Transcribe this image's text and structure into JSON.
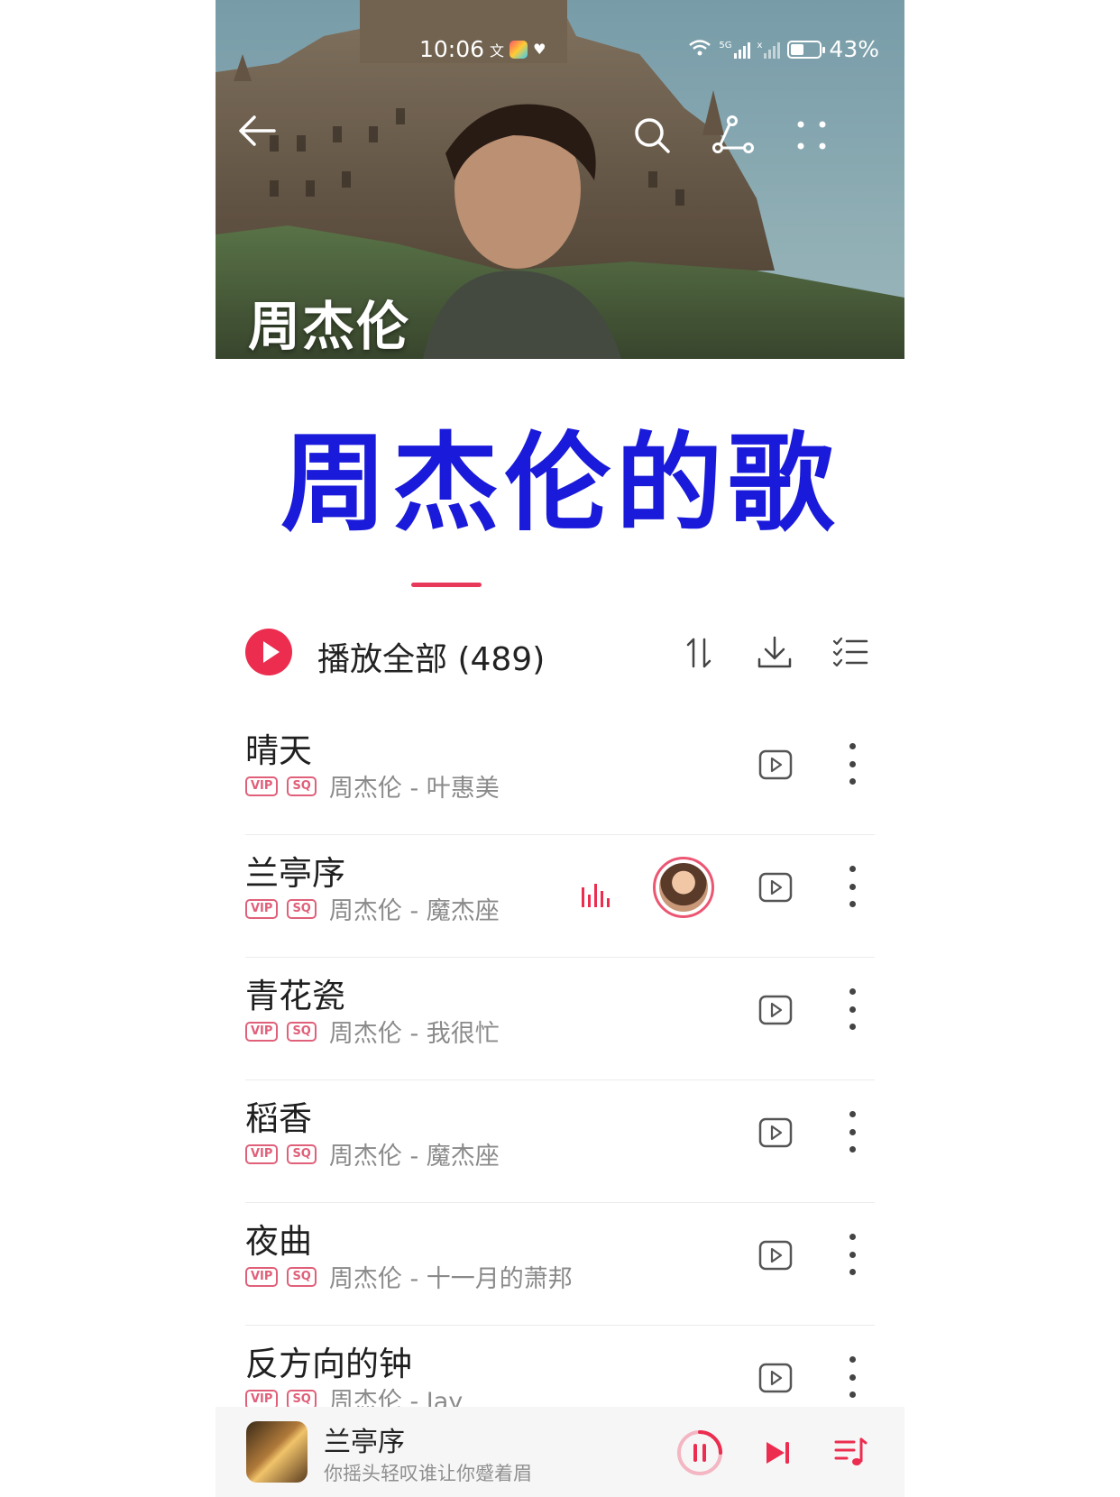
{
  "status_bar": {
    "time": "10:06",
    "battery": "43%",
    "network_5g": "5G",
    "network_x": "x"
  },
  "header": {
    "artist_name": "周杰伦",
    "back_icon": "arrow-left-icon",
    "search_icon": "search-icon",
    "share_icon": "share-icon",
    "more_icon": "more-dots-icon"
  },
  "overlay_title": "周杰伦的歌",
  "toolbar": {
    "play_all_label": "播放全部 (489)",
    "sort_icon": "sort-icon",
    "download_icon": "download-icon",
    "multi_select_icon": "checklist-icon"
  },
  "songs": [
    {
      "title": "晴天",
      "tags": [
        "VIP",
        "SQ"
      ],
      "subtitle": "周杰伦 - 叶惠美",
      "playing": false
    },
    {
      "title": "兰亭序",
      "tags": [
        "VIP",
        "SQ"
      ],
      "subtitle": "周杰伦 - 魔杰座",
      "playing": true
    },
    {
      "title": "青花瓷",
      "tags": [
        "VIP",
        "SQ"
      ],
      "subtitle": "周杰伦 - 我很忙",
      "playing": false
    },
    {
      "title": "稻香",
      "tags": [
        "VIP",
        "SQ"
      ],
      "subtitle": "周杰伦 - 魔杰座",
      "playing": false
    },
    {
      "title": "夜曲",
      "tags": [
        "VIP",
        "SQ"
      ],
      "subtitle": "周杰伦 - 十一月的萧邦",
      "playing": false
    },
    {
      "title": "反方向的钟",
      "tags": [
        "VIP",
        "SQ"
      ],
      "subtitle": "周杰伦 - Jay",
      "playing": false
    }
  ],
  "mini_player": {
    "title": "兰亭序",
    "lyric": "你摇头轻叹谁让你蹙着眉"
  },
  "colors": {
    "accent": "#ec2d4f",
    "overlay_title": "#1a1adb",
    "tag": "#e0607a"
  }
}
